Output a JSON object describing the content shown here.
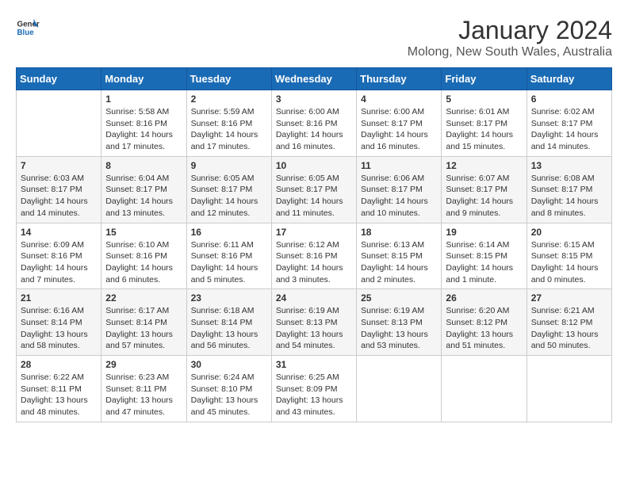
{
  "header": {
    "logo_general": "General",
    "logo_blue": "Blue",
    "title": "January 2024",
    "subtitle": "Molong, New South Wales, Australia"
  },
  "weekdays": [
    "Sunday",
    "Monday",
    "Tuesday",
    "Wednesday",
    "Thursday",
    "Friday",
    "Saturday"
  ],
  "weeks": [
    [
      {
        "day": "",
        "info": ""
      },
      {
        "day": "1",
        "info": "Sunrise: 5:58 AM\nSunset: 8:16 PM\nDaylight: 14 hours\nand 17 minutes."
      },
      {
        "day": "2",
        "info": "Sunrise: 5:59 AM\nSunset: 8:16 PM\nDaylight: 14 hours\nand 17 minutes."
      },
      {
        "day": "3",
        "info": "Sunrise: 6:00 AM\nSunset: 8:16 PM\nDaylight: 14 hours\nand 16 minutes."
      },
      {
        "day": "4",
        "info": "Sunrise: 6:00 AM\nSunset: 8:17 PM\nDaylight: 14 hours\nand 16 minutes."
      },
      {
        "day": "5",
        "info": "Sunrise: 6:01 AM\nSunset: 8:17 PM\nDaylight: 14 hours\nand 15 minutes."
      },
      {
        "day": "6",
        "info": "Sunrise: 6:02 AM\nSunset: 8:17 PM\nDaylight: 14 hours\nand 14 minutes."
      }
    ],
    [
      {
        "day": "7",
        "info": "Sunrise: 6:03 AM\nSunset: 8:17 PM\nDaylight: 14 hours\nand 14 minutes."
      },
      {
        "day": "8",
        "info": "Sunrise: 6:04 AM\nSunset: 8:17 PM\nDaylight: 14 hours\nand 13 minutes."
      },
      {
        "day": "9",
        "info": "Sunrise: 6:05 AM\nSunset: 8:17 PM\nDaylight: 14 hours\nand 12 minutes."
      },
      {
        "day": "10",
        "info": "Sunrise: 6:05 AM\nSunset: 8:17 PM\nDaylight: 14 hours\nand 11 minutes."
      },
      {
        "day": "11",
        "info": "Sunrise: 6:06 AM\nSunset: 8:17 PM\nDaylight: 14 hours\nand 10 minutes."
      },
      {
        "day": "12",
        "info": "Sunrise: 6:07 AM\nSunset: 8:17 PM\nDaylight: 14 hours\nand 9 minutes."
      },
      {
        "day": "13",
        "info": "Sunrise: 6:08 AM\nSunset: 8:17 PM\nDaylight: 14 hours\nand 8 minutes."
      }
    ],
    [
      {
        "day": "14",
        "info": "Sunrise: 6:09 AM\nSunset: 8:16 PM\nDaylight: 14 hours\nand 7 minutes."
      },
      {
        "day": "15",
        "info": "Sunrise: 6:10 AM\nSunset: 8:16 PM\nDaylight: 14 hours\nand 6 minutes."
      },
      {
        "day": "16",
        "info": "Sunrise: 6:11 AM\nSunset: 8:16 PM\nDaylight: 14 hours\nand 5 minutes."
      },
      {
        "day": "17",
        "info": "Sunrise: 6:12 AM\nSunset: 8:16 PM\nDaylight: 14 hours\nand 3 minutes."
      },
      {
        "day": "18",
        "info": "Sunrise: 6:13 AM\nSunset: 8:15 PM\nDaylight: 14 hours\nand 2 minutes."
      },
      {
        "day": "19",
        "info": "Sunrise: 6:14 AM\nSunset: 8:15 PM\nDaylight: 14 hours\nand 1 minute."
      },
      {
        "day": "20",
        "info": "Sunrise: 6:15 AM\nSunset: 8:15 PM\nDaylight: 14 hours\nand 0 minutes."
      }
    ],
    [
      {
        "day": "21",
        "info": "Sunrise: 6:16 AM\nSunset: 8:14 PM\nDaylight: 13 hours\nand 58 minutes."
      },
      {
        "day": "22",
        "info": "Sunrise: 6:17 AM\nSunset: 8:14 PM\nDaylight: 13 hours\nand 57 minutes."
      },
      {
        "day": "23",
        "info": "Sunrise: 6:18 AM\nSunset: 8:14 PM\nDaylight: 13 hours\nand 56 minutes."
      },
      {
        "day": "24",
        "info": "Sunrise: 6:19 AM\nSunset: 8:13 PM\nDaylight: 13 hours\nand 54 minutes."
      },
      {
        "day": "25",
        "info": "Sunrise: 6:19 AM\nSunset: 8:13 PM\nDaylight: 13 hours\nand 53 minutes."
      },
      {
        "day": "26",
        "info": "Sunrise: 6:20 AM\nSunset: 8:12 PM\nDaylight: 13 hours\nand 51 minutes."
      },
      {
        "day": "27",
        "info": "Sunrise: 6:21 AM\nSunset: 8:12 PM\nDaylight: 13 hours\nand 50 minutes."
      }
    ],
    [
      {
        "day": "28",
        "info": "Sunrise: 6:22 AM\nSunset: 8:11 PM\nDaylight: 13 hours\nand 48 minutes."
      },
      {
        "day": "29",
        "info": "Sunrise: 6:23 AM\nSunset: 8:11 PM\nDaylight: 13 hours\nand 47 minutes."
      },
      {
        "day": "30",
        "info": "Sunrise: 6:24 AM\nSunset: 8:10 PM\nDaylight: 13 hours\nand 45 minutes."
      },
      {
        "day": "31",
        "info": "Sunrise: 6:25 AM\nSunset: 8:09 PM\nDaylight: 13 hours\nand 43 minutes."
      },
      {
        "day": "",
        "info": ""
      },
      {
        "day": "",
        "info": ""
      },
      {
        "day": "",
        "info": ""
      }
    ]
  ]
}
